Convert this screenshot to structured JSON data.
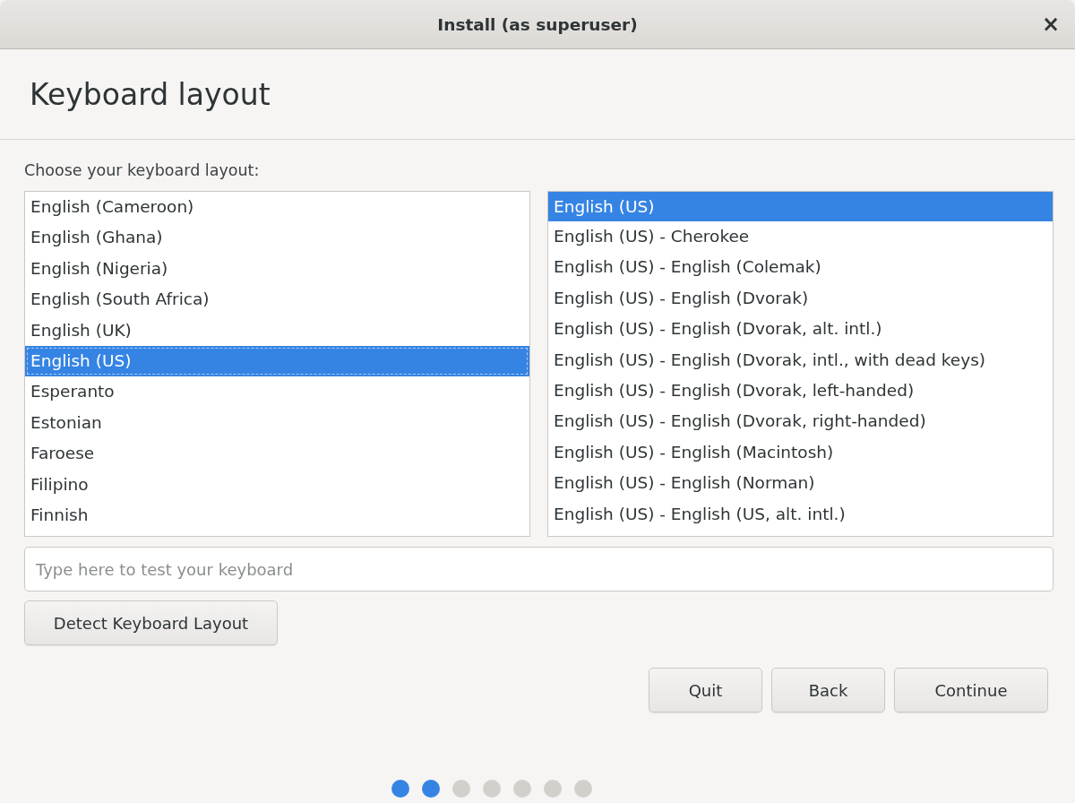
{
  "window": {
    "title": "Install (as superuser)",
    "close": "×"
  },
  "header": {
    "title": "Keyboard layout"
  },
  "prompt": "Choose your keyboard layout:",
  "layouts": [
    {
      "label": "English (Cameroon)",
      "selected": false
    },
    {
      "label": "English (Ghana)",
      "selected": false
    },
    {
      "label": "English (Nigeria)",
      "selected": false
    },
    {
      "label": "English (South Africa)",
      "selected": false
    },
    {
      "label": "English (UK)",
      "selected": false
    },
    {
      "label": "English (US)",
      "selected": true
    },
    {
      "label": "Esperanto",
      "selected": false
    },
    {
      "label": "Estonian",
      "selected": false
    },
    {
      "label": "Faroese",
      "selected": false
    },
    {
      "label": "Filipino",
      "selected": false
    },
    {
      "label": "Finnish",
      "selected": false
    }
  ],
  "variants": [
    {
      "label": "English (US)",
      "selected": true
    },
    {
      "label": "English (US) - Cherokee",
      "selected": false
    },
    {
      "label": "English (US) - English (Colemak)",
      "selected": false
    },
    {
      "label": "English (US) - English (Dvorak)",
      "selected": false
    },
    {
      "label": "English (US) - English (Dvorak, alt. intl.)",
      "selected": false
    },
    {
      "label": "English (US) - English (Dvorak, intl., with dead keys)",
      "selected": false
    },
    {
      "label": "English (US) - English (Dvorak, left-handed)",
      "selected": false
    },
    {
      "label": "English (US) - English (Dvorak, right-handed)",
      "selected": false
    },
    {
      "label": "English (US) - English (Macintosh)",
      "selected": false
    },
    {
      "label": "English (US) - English (Norman)",
      "selected": false
    },
    {
      "label": "English (US) - English (US, alt. intl.)",
      "selected": false
    }
  ],
  "test_field": {
    "placeholder": "Type here to test your keyboard"
  },
  "detect_button": "Detect Keyboard Layout",
  "buttons": [
    "Quit",
    "Back",
    "Continue"
  ],
  "steps": [
    {
      "done": true
    },
    {
      "done": true
    },
    {
      "done": false
    },
    {
      "done": false
    },
    {
      "done": false
    },
    {
      "done": false
    },
    {
      "done": false
    }
  ]
}
